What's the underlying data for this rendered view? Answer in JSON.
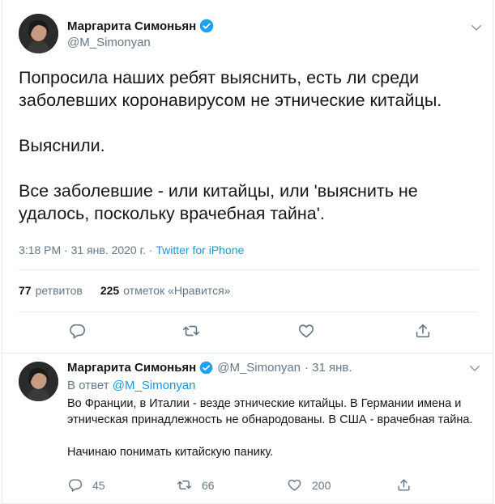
{
  "colors": {
    "text": "#14171a",
    "secondary": "#657786",
    "link": "#1b95e0",
    "border": "#e6ecf0"
  },
  "main_tweet": {
    "author_name": "Маргарита Симоньян",
    "author_handle": "@M_Simonyan",
    "verified_icon": "verified-badge-icon",
    "text": "Попросила наших ребят выяснить, есть ли среди заболевших коронавирусом не этнические китайцы.\n\nВыяснили.\n\nВсе заболевшие - или китайцы, или 'выяснить не удалось, поскольку врачебная тайна'.",
    "time": "3:18 PM · 31 янв. 2020 г. · ",
    "source": "Twitter for iPhone",
    "retweets_count": "77",
    "retweets_label": "ретвитов",
    "likes_count": "225",
    "likes_label": "отметок «Нравится»",
    "actions": [
      "reply-icon",
      "retweet-icon",
      "like-icon",
      "share-icon"
    ]
  },
  "reply_tweet": {
    "author_name": "Маргарита Симоньян",
    "author_handle": "@M_Simonyan",
    "date": "· 31 янв.",
    "in_reply_prefix": "В ответ ",
    "in_reply_handle": "@M_Simonyan",
    "text": "Во Франции, в Италии - везде этнические китайцы. В Германии имена и этническая принадлежность не обнародованы. В США - врачебная тайна.\n\nНачинаю понимать китайскую панику.",
    "reply_count": "45",
    "retweet_count": "66",
    "like_count": "200"
  }
}
